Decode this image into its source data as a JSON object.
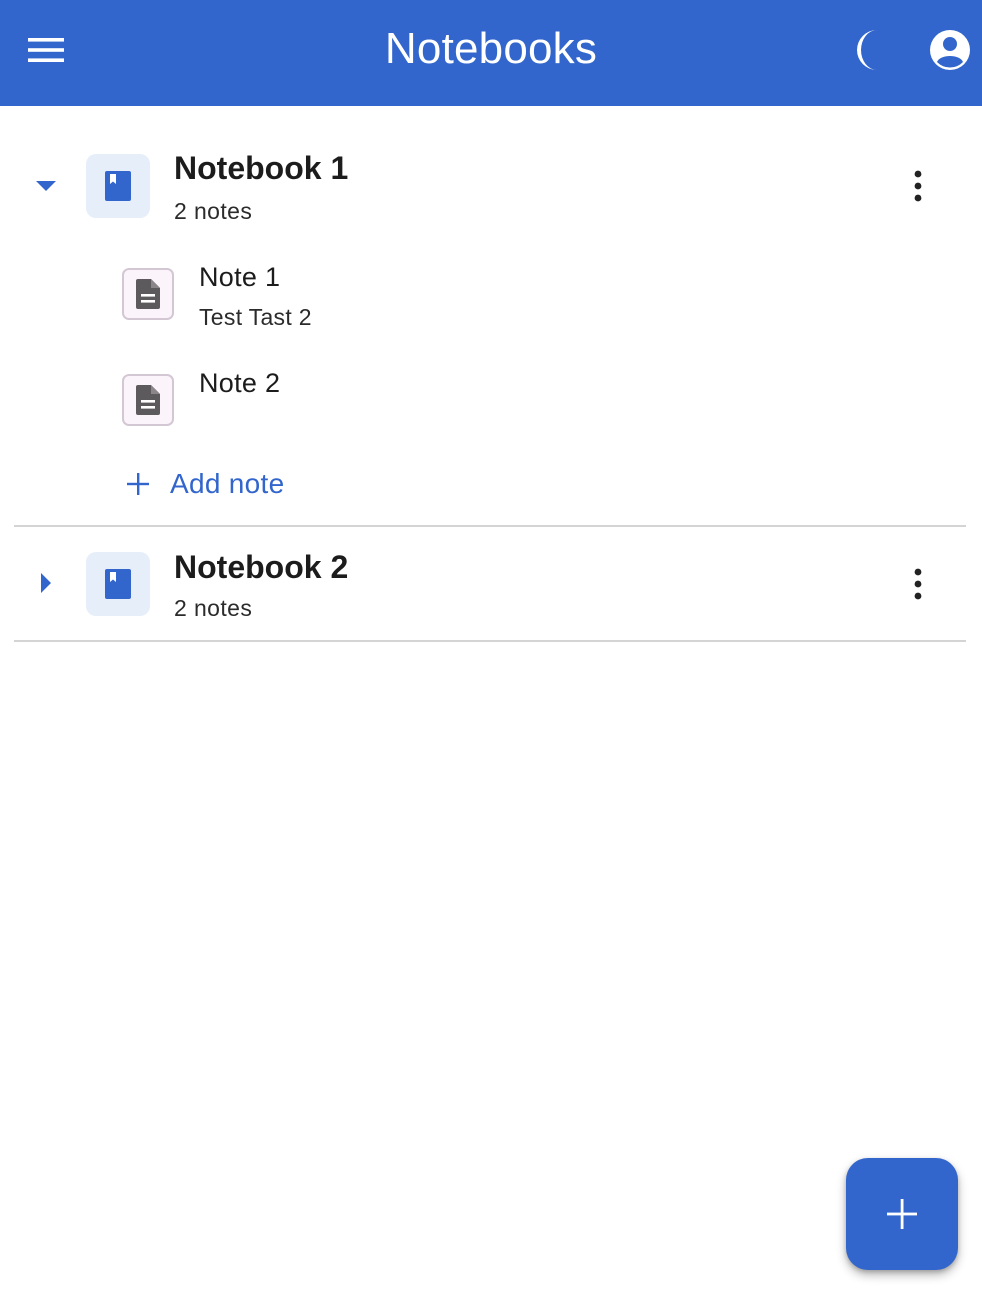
{
  "app_bar": {
    "title": "Notebooks",
    "background_color": "#3266cc",
    "icons": {
      "menu": "menu-icon",
      "theme": "dark-mode-moon-icon",
      "account": "account-circle-icon"
    }
  },
  "notebooks": [
    {
      "title": "Notebook 1",
      "count_label": "2 notes",
      "expanded": true,
      "icon": "book-icon",
      "notes": [
        {
          "title": "Note 1",
          "subtitle": "Test Tast 2",
          "icon": "document-icon"
        },
        {
          "title": "Note 2",
          "subtitle": "",
          "icon": "document-icon"
        }
      ],
      "add_note_label": "Add note"
    },
    {
      "title": "Notebook 2",
      "count_label": "2 notes",
      "expanded": false,
      "icon": "book-icon"
    }
  ],
  "fab": {
    "icon": "plus-icon"
  },
  "colors": {
    "primary": "#3266cc",
    "notebook_avatar_bg": "#e6eef9",
    "note_icon_border": "#d3c7d4",
    "note_icon_fill": "#5c5a5c",
    "divider": "#d4d4d4"
  }
}
